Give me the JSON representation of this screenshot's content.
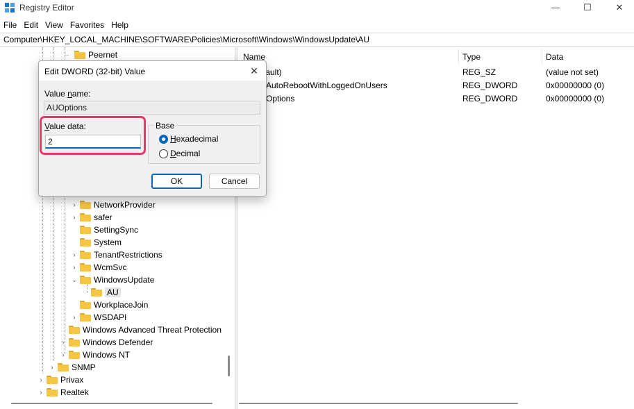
{
  "window": {
    "title": "Registry Editor",
    "minimize": "—",
    "maximize": "☐",
    "close": "✕"
  },
  "menu": [
    "File",
    "Edit",
    "View",
    "Favorites",
    "Help"
  ],
  "address": "Computer\\HKEY_LOCAL_MACHINE\\SOFTWARE\\Policies\\Microsoft\\Windows\\WindowsUpdate\\AU",
  "tree": {
    "items": [
      {
        "label": "Peernet"
      },
      {
        "label": "NetworkProvider"
      },
      {
        "label": "safer"
      },
      {
        "label": "SettingSync"
      },
      {
        "label": "System"
      },
      {
        "label": "TenantRestrictions"
      },
      {
        "label": "WcmSvc"
      },
      {
        "label": "WindowsUpdate"
      },
      {
        "label": "AU"
      },
      {
        "label": "WorkplaceJoin"
      },
      {
        "label": "WSDAPI"
      },
      {
        "label": "Windows Advanced Threat Protection"
      },
      {
        "label": "Windows Defender"
      },
      {
        "label": "Windows NT"
      },
      {
        "label": "SNMP"
      },
      {
        "label": "Privax"
      },
      {
        "label": "Realtek"
      }
    ],
    "selected": "AU"
  },
  "list": {
    "columns": {
      "name": "Name",
      "type": "Type",
      "data": "Data"
    },
    "rows": [
      {
        "name": "fault)",
        "type": "REG_SZ",
        "data": "(value not set)"
      },
      {
        "name": "AutoRebootWithLoggedOnUsers",
        "type": "REG_DWORD",
        "data": "0x00000000 (0)"
      },
      {
        "name": "Options",
        "type": "REG_DWORD",
        "data": "0x00000000 (0)"
      }
    ]
  },
  "dialog": {
    "title": "Edit DWORD (32-bit) Value",
    "close": "✕",
    "value_name_label_pre": "Value ",
    "value_name_label_u": "n",
    "value_name_label_post": "ame:",
    "value_name": "AUOptions",
    "value_data_label_u": "V",
    "value_data_label_post": "alue data:",
    "value_data": "2",
    "base_label": "Base",
    "hex_u": "H",
    "hex_post": "exadecimal",
    "dec_u": "D",
    "dec_post": "ecimal",
    "base_selected": "Hexadecimal",
    "ok": "OK",
    "cancel": "Cancel",
    "highlight_color": "#e8386b"
  }
}
